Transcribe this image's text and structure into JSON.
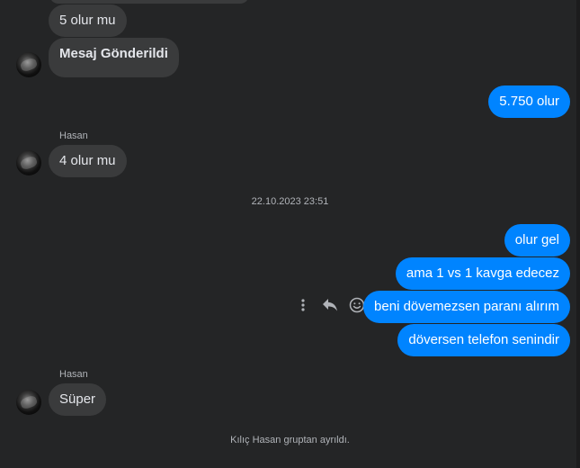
{
  "messages": {
    "prev_cut": "",
    "m1": "5 olur mu",
    "m2": "Mesaj Gönderildi",
    "m3": "5.750 olur",
    "sender1": "Hasan",
    "m4": "4 olur mu",
    "timestamp": "22.10.2023 23:51",
    "m5": "olur gel",
    "m6": "ama 1 vs 1 kavga edecez",
    "m7": "beni dövemezsen paranı alırım",
    "m8": "döversen telefon senindir",
    "sender2": "Hasan",
    "m9": "Süper",
    "system_notice": "Kılıç Hasan gruptan ayrıldı."
  },
  "colors": {
    "background": "#242526",
    "incoming_bubble": "#3a3b3c",
    "outgoing_bubble": "#0084ff",
    "meta_text": "#b0b3b8"
  },
  "icons": {
    "more": "more-vertical-icon",
    "reply": "reply-icon",
    "react": "smiley-icon"
  }
}
